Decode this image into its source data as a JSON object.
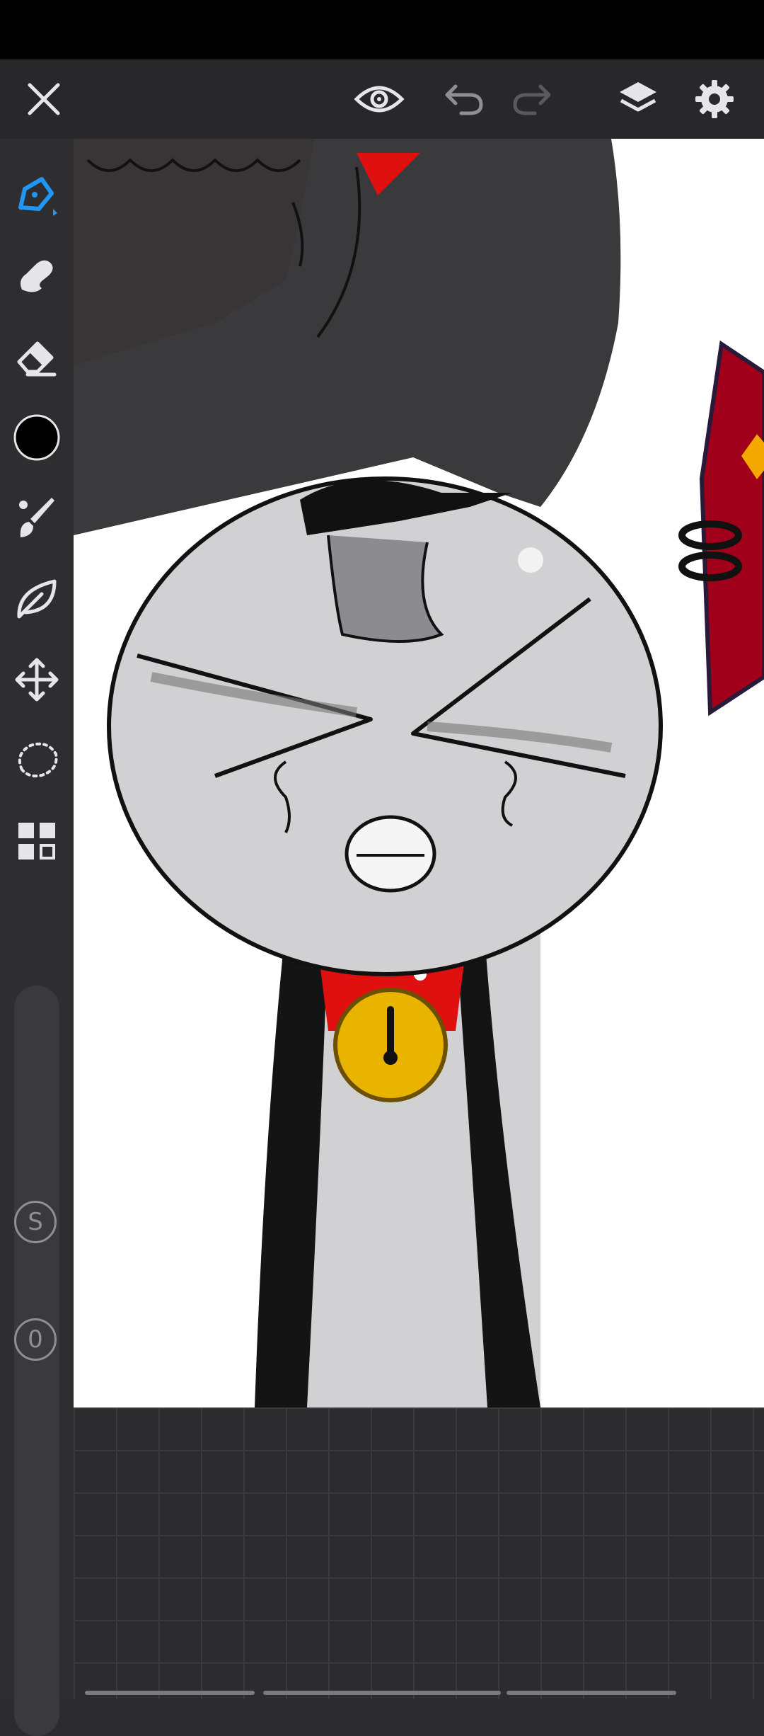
{
  "app": {
    "toolbar": {
      "close": "close",
      "preview": "preview",
      "undo": "undo",
      "redo": "redo",
      "layers": "layers",
      "settings": "settings"
    },
    "tools": [
      {
        "name": "pen-tool",
        "icon": "pen-icon",
        "active": true
      },
      {
        "name": "smudge-tool",
        "icon": "smudge-icon"
      },
      {
        "name": "eraser-tool",
        "icon": "eraser-icon"
      },
      {
        "name": "color-picker",
        "icon": "color-swatch",
        "color": "#000000"
      },
      {
        "name": "brush-tool",
        "icon": "brush-icon"
      },
      {
        "name": "lasso-fill-tool",
        "icon": "leaf-icon"
      },
      {
        "name": "transform-tool",
        "icon": "move-arrows-icon"
      },
      {
        "name": "selection-tool",
        "icon": "dotted-lasso-icon"
      },
      {
        "name": "tools-menu",
        "icon": "grid-icon"
      }
    ],
    "sliders": {
      "size_label": "S",
      "opacity_label": "0"
    }
  },
  "colors": {
    "accent": "#2196f3",
    "toolbar_bg": "#28282a",
    "sidebar_bg": "#2e2e30",
    "canvas_bg": "#ffffff"
  }
}
